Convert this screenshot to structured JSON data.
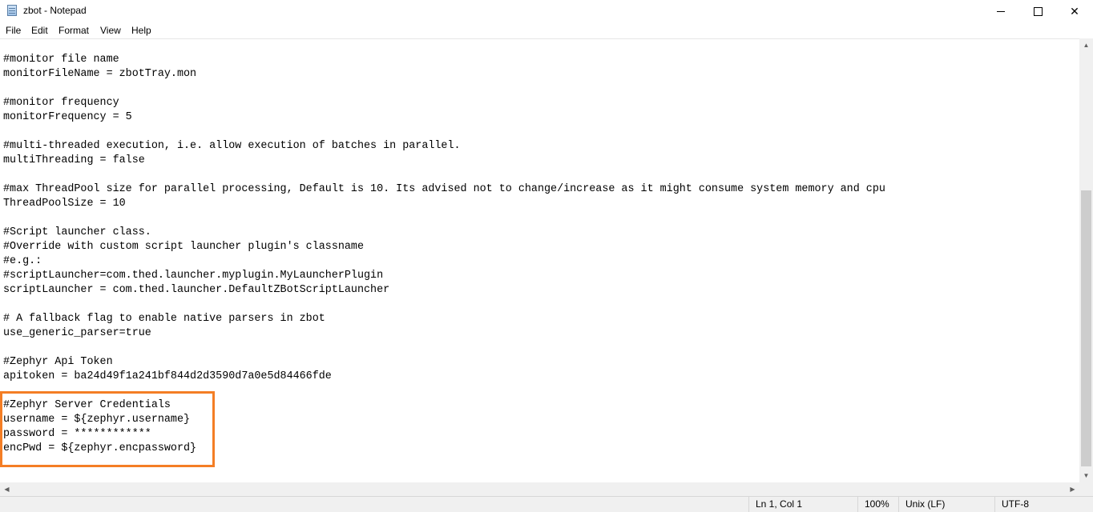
{
  "window": {
    "title": "zbot - Notepad"
  },
  "menu": {
    "file": "File",
    "edit": "Edit",
    "format": "Format",
    "view": "View",
    "help": "Help"
  },
  "editor": {
    "content": "#monitor file name\nmonitorFileName = zbotTray.mon\n\n#monitor frequency\nmonitorFrequency = 5\n\n#multi-threaded execution, i.e. allow execution of batches in parallel.\nmultiThreading = false\n\n#max ThreadPool size for parallel processing, Default is 10. Its advised not to change/increase as it might consume system memory and cpu\nThreadPoolSize = 10\n\n#Script launcher class.\n#Override with custom script launcher plugin's classname\n#e.g.:\n#scriptLauncher=com.thed.launcher.myplugin.MyLauncherPlugin\nscriptLauncher = com.thed.launcher.DefaultZBotScriptLauncher\n\n# A fallback flag to enable native parsers in zbot\nuse_generic_parser=true\n\n#Zephyr Api Token\napitoken = ba24d49f1a241bf844d2d3590d7a0e5d84466fde\n\n#Zephyr Server Credentials\nusername = ${zephyr.username}\npassword = ************\nencPwd = ${zephyr.encpassword}"
  },
  "highlight_color": "#f47e25",
  "status": {
    "position": "Ln 1, Col 1",
    "zoom": "100%",
    "line_endings": "Unix (LF)",
    "encoding": "UTF-8"
  },
  "icons": {
    "app": "notepad-icon",
    "minimize": "minimize-icon",
    "maximize": "maximize-icon",
    "close": "close-icon"
  }
}
